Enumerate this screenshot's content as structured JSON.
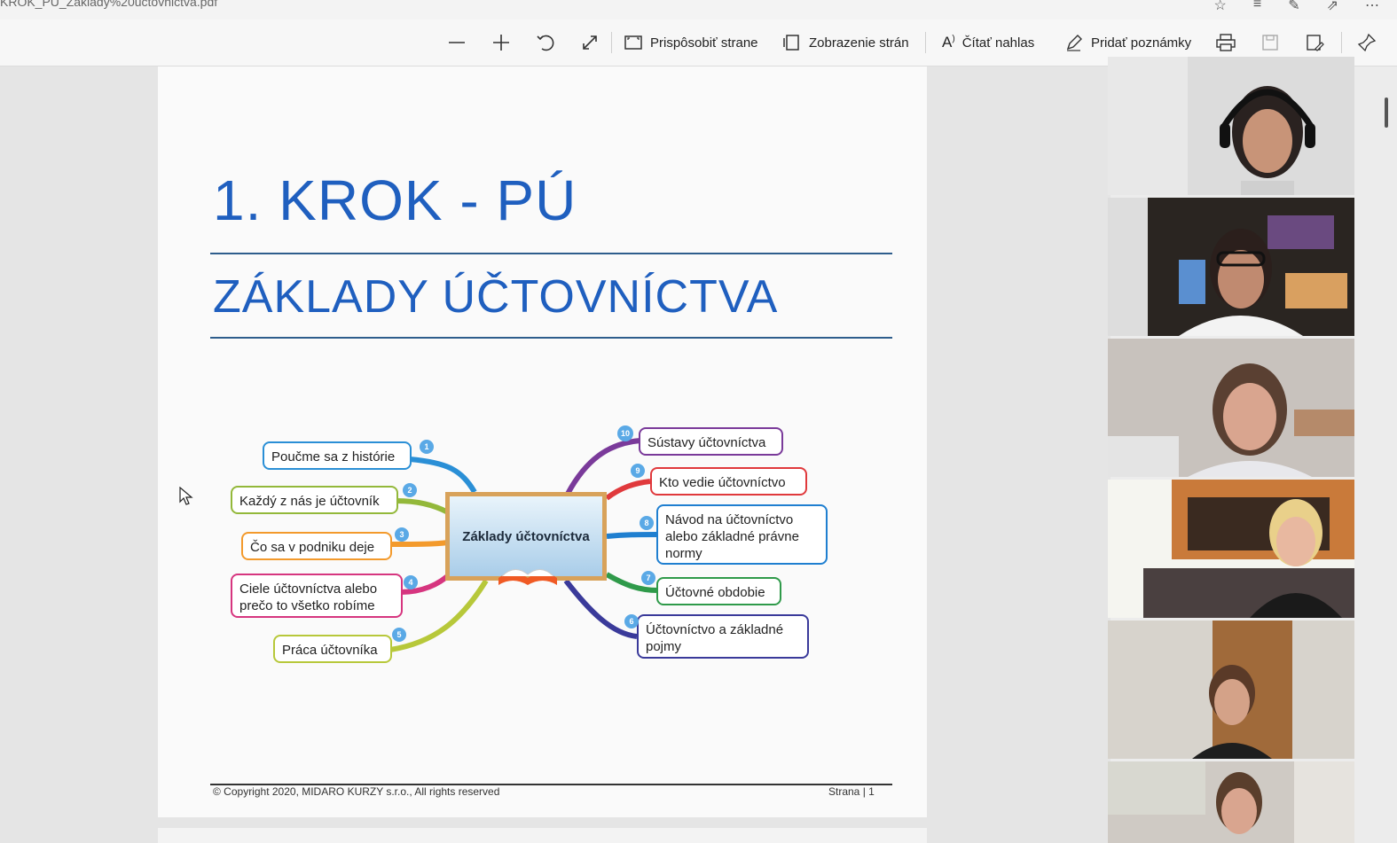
{
  "window": {
    "filename": "KROK_PU_Zaklady%20uctovnictva.pdf"
  },
  "toolbar": {
    "zoom_out": "—",
    "zoom_in": "+",
    "fit_page": "Prispôsobiť strane",
    "page_view": "Zobrazenie strán",
    "read_aloud": "Čítať nahlas",
    "add_notes": "Pridať poznámky"
  },
  "page": {
    "title": "1. KROK - PÚ",
    "subtitle": "ZÁKLADY ÚČTOVNÍCTVA",
    "footer_left": "© Copyright 2020, MIDARO KURZY s.r.o., All rights reserved",
    "footer_right": "Strana | 1"
  },
  "mindmap": {
    "center": "Základy účtovníctva",
    "nodes": [
      {
        "num": "1",
        "label": "Poučme sa z histórie",
        "color": "#2a8fd6"
      },
      {
        "num": "2",
        "label": "Každý z nás je účtovník",
        "color": "#93b83a"
      },
      {
        "num": "3",
        "label": "Čo sa v podniku deje",
        "color": "#f39a2c"
      },
      {
        "num": "4",
        "label": "Ciele účtovníctva alebo prečo to všetko robíme",
        "color": "#d6357f"
      },
      {
        "num": "5",
        "label": "Práca účtovníka",
        "color": "#b7c83a"
      },
      {
        "num": "6",
        "label": "Účtovníctvo a základné pojmy",
        "color": "#3a3a9a"
      },
      {
        "num": "7",
        "label": "Účtovné obdobie",
        "color": "#2f9a4a"
      },
      {
        "num": "8",
        "label": "Návod na účtovníctvo alebo základné právne normy",
        "color": "#1f7fd0"
      },
      {
        "num": "9",
        "label": "Kto vedie účtovníctvo",
        "color": "#e0393c"
      },
      {
        "num": "10",
        "label": "Sústavy účtovníctva",
        "color": "#7a3a9a"
      }
    ]
  },
  "participants": [
    {
      "name": "participant-1"
    },
    {
      "name": "participant-2"
    },
    {
      "name": "participant-3"
    },
    {
      "name": "participant-4"
    },
    {
      "name": "participant-5"
    },
    {
      "name": "participant-6"
    }
  ]
}
